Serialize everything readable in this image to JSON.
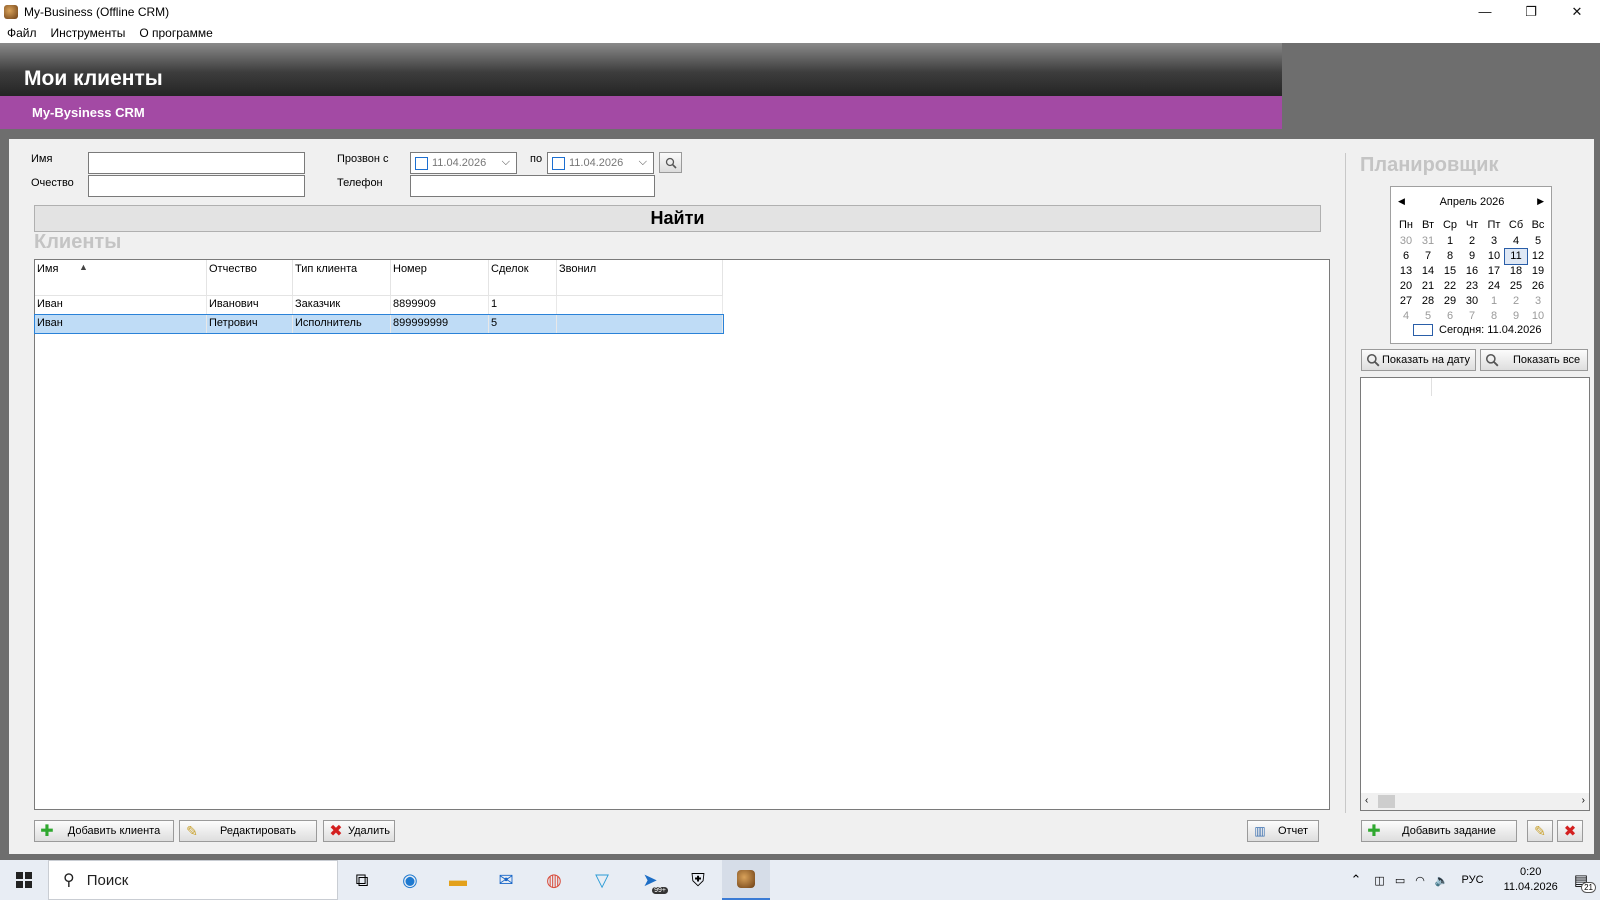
{
  "window": {
    "title": "My-Business (Offline CRM)",
    "minimize": "—",
    "restore": "❐",
    "close": "✕"
  },
  "menu": [
    "Файл",
    "Инструменты",
    "О программе"
  ],
  "banner": {
    "title": "Мои клиенты",
    "subtitle": "My-Bysiness CRM"
  },
  "filters": {
    "name_label": "Имя",
    "patronymic_label": "Очество",
    "call_from_label": "Прозвон с",
    "call_to_label": "по",
    "phone_label": "Телефон",
    "date_from": "11.04.2026",
    "date_to": "11.04.2026",
    "name_value": "",
    "patronymic_value": "",
    "phone_value": ""
  },
  "find_button": "Найти",
  "clients": {
    "title": "Клиенты",
    "columns": [
      "Имя",
      "Отчество",
      "Тип клиента",
      "Номер",
      "Сделок",
      "Звонил"
    ],
    "rows": [
      [
        "Иван",
        "Иванович",
        "Заказчик",
        "8899909",
        "1",
        ""
      ],
      [
        "Иван",
        "Петрович",
        "Исполнитель",
        "899999999",
        "5",
        ""
      ]
    ],
    "selected_row": 1
  },
  "actions": {
    "add_client": "Добавить клиента",
    "edit": "Редактировать",
    "delete": "Удалить",
    "report": "Отчет"
  },
  "planner": {
    "title": "Планировщик",
    "month_label": "Апрель 2026",
    "weekdays": [
      "Пн",
      "Вт",
      "Ср",
      "Чт",
      "Пт",
      "Сб",
      "Вс"
    ],
    "weeks": [
      [
        "30",
        "31",
        "1",
        "2",
        "3",
        "4",
        "5"
      ],
      [
        "6",
        "7",
        "8",
        "9",
        "10",
        "11",
        "12"
      ],
      [
        "13",
        "14",
        "15",
        "16",
        "17",
        "18",
        "19"
      ],
      [
        "20",
        "21",
        "22",
        "23",
        "24",
        "25",
        "26"
      ],
      [
        "27",
        "28",
        "29",
        "30",
        "1",
        "2",
        "3"
      ],
      [
        "4",
        "5",
        "6",
        "7",
        "8",
        "9",
        "10"
      ]
    ],
    "today_label": "Сегодня: 11.04.2026",
    "show_on_date": "Показать на дату",
    "show_all": "Показать все",
    "add_task": "Добавить задание"
  },
  "taskbar": {
    "search_placeholder": "Поиск",
    "language": "РУС",
    "time": "0:20",
    "date": "11.04.2026",
    "notifications": "21",
    "badge": "99+"
  },
  "colors": {
    "accent_purple": "#a34aa4",
    "selection": "#bfdcf6"
  }
}
